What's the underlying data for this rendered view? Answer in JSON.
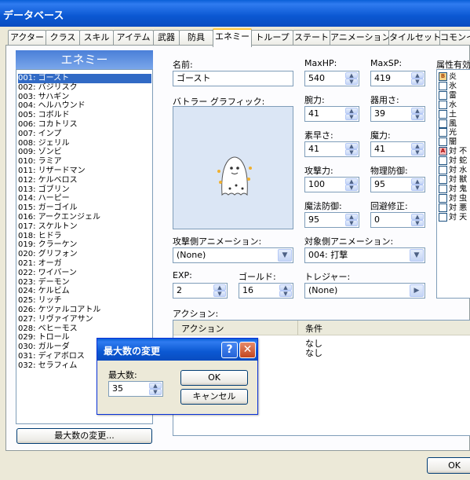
{
  "window": {
    "title": "データベース"
  },
  "tabs": [
    "アクター",
    "クラス",
    "スキル",
    "アイテム",
    "武器",
    "防具",
    "エネミー",
    "トループ",
    "ステート",
    "アニメーション",
    "タイルセット",
    "コモンイベ"
  ],
  "active_tab_index": 6,
  "enemy_list": {
    "header": "エネミー",
    "items": [
      "001: ゴースト",
      "002: バジリスク",
      "003: サハギン",
      "004: ヘルハウンド",
      "005: コボルド",
      "006: コカトリス",
      "007: インプ",
      "008: ジェリル",
      "009: ゾンビ",
      "010: ラミア",
      "011: リザードマン",
      "012: ケルベロス",
      "013: ゴブリン",
      "014: ハーピー",
      "015: ガーゴイル",
      "016: アークエンジェル",
      "017: スケルトン",
      "018: ヒドラ",
      "019: クラーケン",
      "020: グリフォン",
      "021: オーガ",
      "022: ワイバーン",
      "023: デーモン",
      "024: ケルビム",
      "025: リッチ",
      "026: ケツァルコアトル",
      "027: リヴァイアサン",
      "028: ベヒーモス",
      "029: トロール",
      "030: ガルーダ",
      "031: ディアボロス",
      "032: セラフィム"
    ],
    "selected_index": 0,
    "max_button": "最大数の変更..."
  },
  "form": {
    "name_label": "名前:",
    "name_value": "ゴースト",
    "battler_label": "バトラー グラフィック:",
    "maxhp_label": "MaxHP:",
    "maxhp": "540",
    "maxsp_label": "MaxSP:",
    "maxsp": "419",
    "str_label": "腕力:",
    "str": "41",
    "dex_label": "器用さ:",
    "dex": "39",
    "agi_label": "素早さ:",
    "agi": "41",
    "int_label": "魔力:",
    "int": "41",
    "atk_label": "攻撃力:",
    "atk": "100",
    "pdef_label": "物理防御:",
    "pdef": "95",
    "mdef_label": "魔法防御:",
    "mdef": "95",
    "eva_label": "回避修正:",
    "eva": "0",
    "atk_anim_label": "攻撃側アニメーション:",
    "atk_anim": "(None)",
    "tgt_anim_label": "対象側アニメーション:",
    "tgt_anim": "004: 打撃",
    "exp_label": "EXP:",
    "exp": "2",
    "gold_label": "ゴールド:",
    "gold": "16",
    "treasure_label": "トレジャー:",
    "treasure": "(None)",
    "action_label": "アクション:",
    "action_col": "アクション",
    "cond_col": "条件",
    "actions": [
      {
        "action": "",
        "cond": "なし"
      },
      {
        "action": "",
        "cond": "なし"
      }
    ]
  },
  "elements": {
    "label": "属性有効",
    "items": [
      {
        "mark": "B",
        "name": "炎"
      },
      {
        "mark": "",
        "name": "氷"
      },
      {
        "mark": "",
        "name": "雷"
      },
      {
        "mark": "",
        "name": "水"
      },
      {
        "mark": "",
        "name": "土"
      },
      {
        "mark": "",
        "name": "風"
      },
      {
        "mark": "",
        "name": "光"
      },
      {
        "mark": "",
        "name": "闇"
      },
      {
        "mark": "A",
        "name": "対 不"
      },
      {
        "mark": "",
        "name": "対 蛇"
      },
      {
        "mark": "",
        "name": "対 水"
      },
      {
        "mark": "",
        "name": "対 獣"
      },
      {
        "mark": "",
        "name": "対 鬼"
      },
      {
        "mark": "",
        "name": "対 虫"
      },
      {
        "mark": "",
        "name": "対 悪"
      },
      {
        "mark": "",
        "name": "対 天"
      }
    ]
  },
  "dialog": {
    "title": "最大数の変更",
    "max_label": "最大数:",
    "max_value": "35",
    "ok": "OK",
    "cancel": "キャンセル"
  },
  "bottom": {
    "ok": "OK"
  }
}
